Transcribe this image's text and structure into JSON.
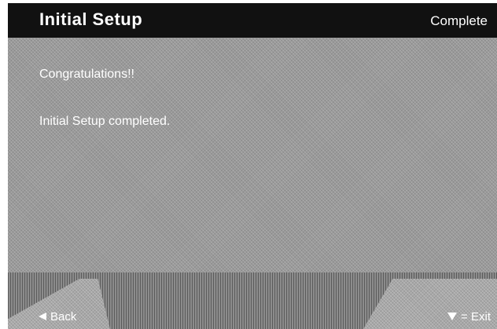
{
  "header": {
    "title": "Initial  Setup",
    "status": "Complete"
  },
  "content": {
    "line1": "Congratulations!!",
    "line2": "Initial Setup completed."
  },
  "footer": {
    "back_label": "Back",
    "back_icon": "left-arrow-icon",
    "exit_label": "Exit",
    "exit_icon": "down-arrow-icon",
    "exit_prefix": "="
  }
}
